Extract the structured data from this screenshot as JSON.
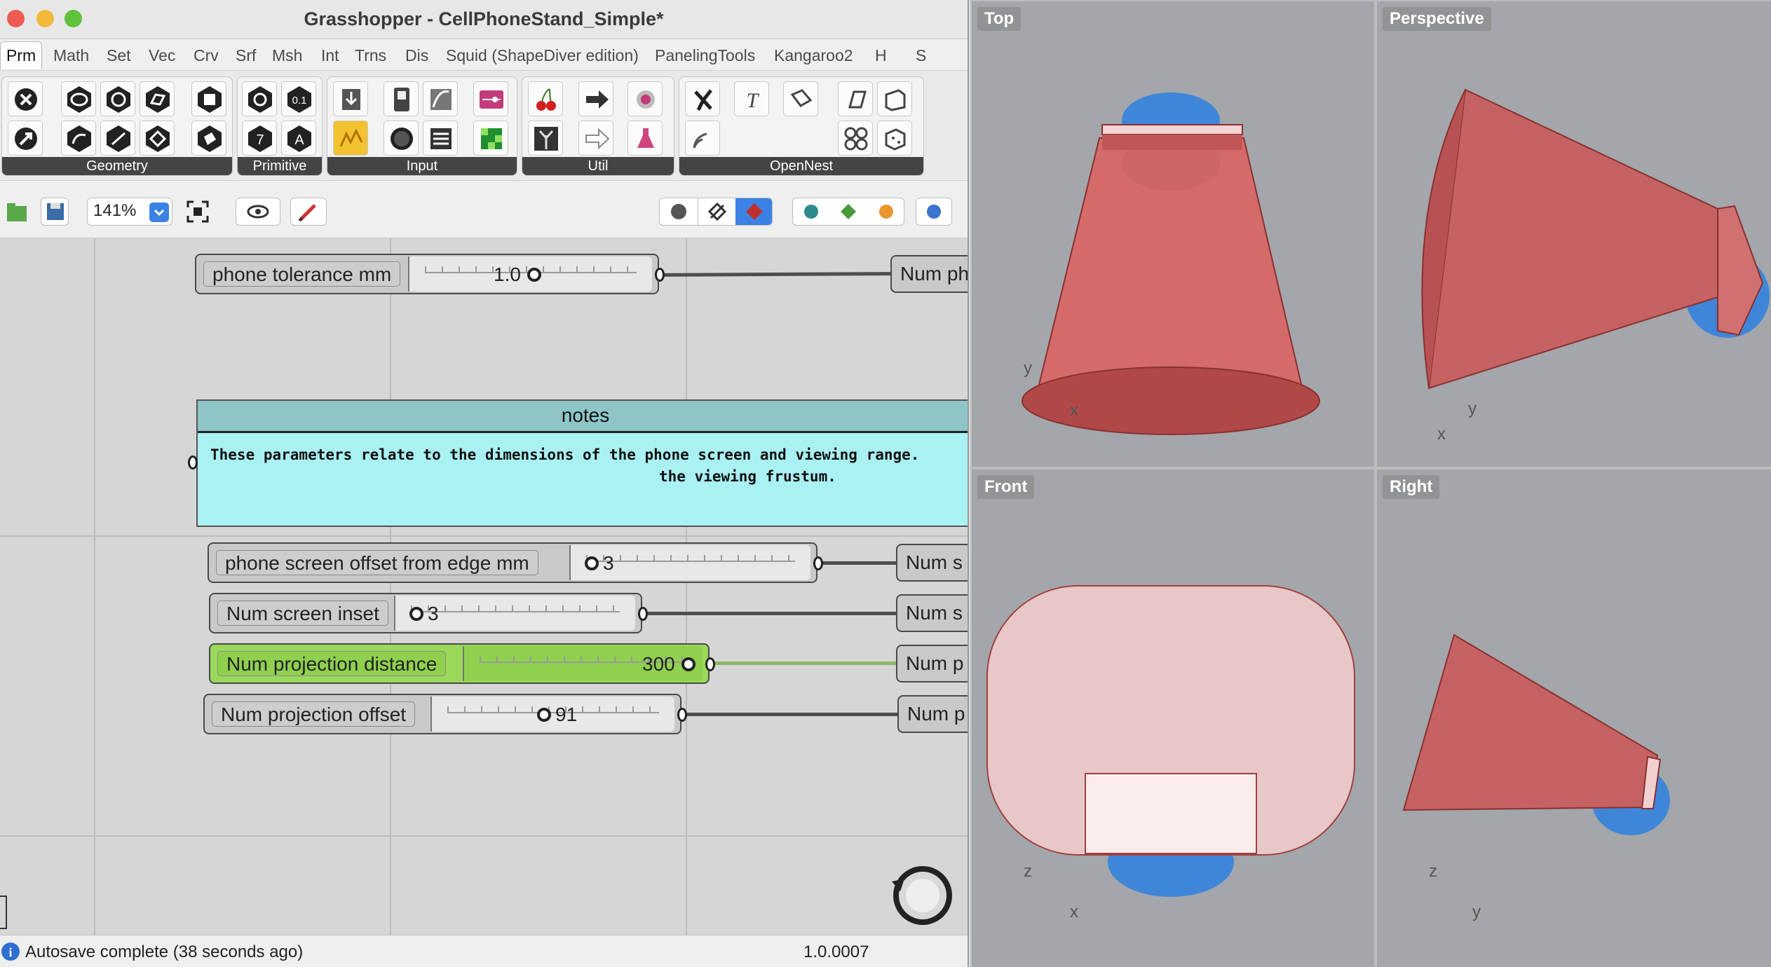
{
  "window": {
    "title": "Grasshopper - CellPhoneStand_Simple*"
  },
  "tabs": [
    "Prm",
    "Math",
    "Set",
    "Vec",
    "Crv",
    "Srf",
    "Msh",
    "Int",
    "Trns",
    "Dis",
    "Squid (ShapeDiver edition)",
    "PanelingTools",
    "Kangaroo2",
    "H",
    "S"
  ],
  "ribbon": {
    "groups": [
      "Geometry",
      "Primitive",
      "Input",
      "Util",
      "OpenNest"
    ],
    "primitive_icon_text": [
      "0.1",
      "7",
      "A"
    ]
  },
  "toolbar": {
    "zoom": "141%"
  },
  "canvas": {
    "notes": {
      "title": "notes",
      "line1": "These parameters relate to the dimensions of the phone screen and viewing range.",
      "line2": "the viewing frustum."
    },
    "sliders": [
      {
        "label": "phone tolerance mm",
        "value": "1.0",
        "target": "Num ph"
      },
      {
        "label": "phone  screen offset from edge mm",
        "value": "3",
        "target": "Num s"
      },
      {
        "label": "Num screen inset",
        "value": "3",
        "target": "Num s"
      },
      {
        "label": "Num projection distance",
        "value": "300",
        "target": "Num p"
      },
      {
        "label": "Num projection offset",
        "value": "91",
        "target": "Num p"
      }
    ]
  },
  "status": {
    "message": "Autosave complete (38 seconds ago)",
    "version": "1.0.0007"
  },
  "viewports": [
    {
      "name": "Top",
      "axes": [
        "x",
        "y"
      ]
    },
    {
      "name": "Perspective",
      "axes": [
        "y",
        "x"
      ]
    },
    {
      "name": "Front",
      "axes": [
        "z",
        "x"
      ]
    },
    {
      "name": "Right",
      "axes": [
        "z",
        "y"
      ]
    }
  ],
  "colors": {
    "selected_slider": "#8fd14f",
    "notes_bg": "#a9f1f3",
    "stand_red": "#c85a5a",
    "sphere_blue": "#3f86d8",
    "viewport_bg": "#a3a6aa"
  }
}
